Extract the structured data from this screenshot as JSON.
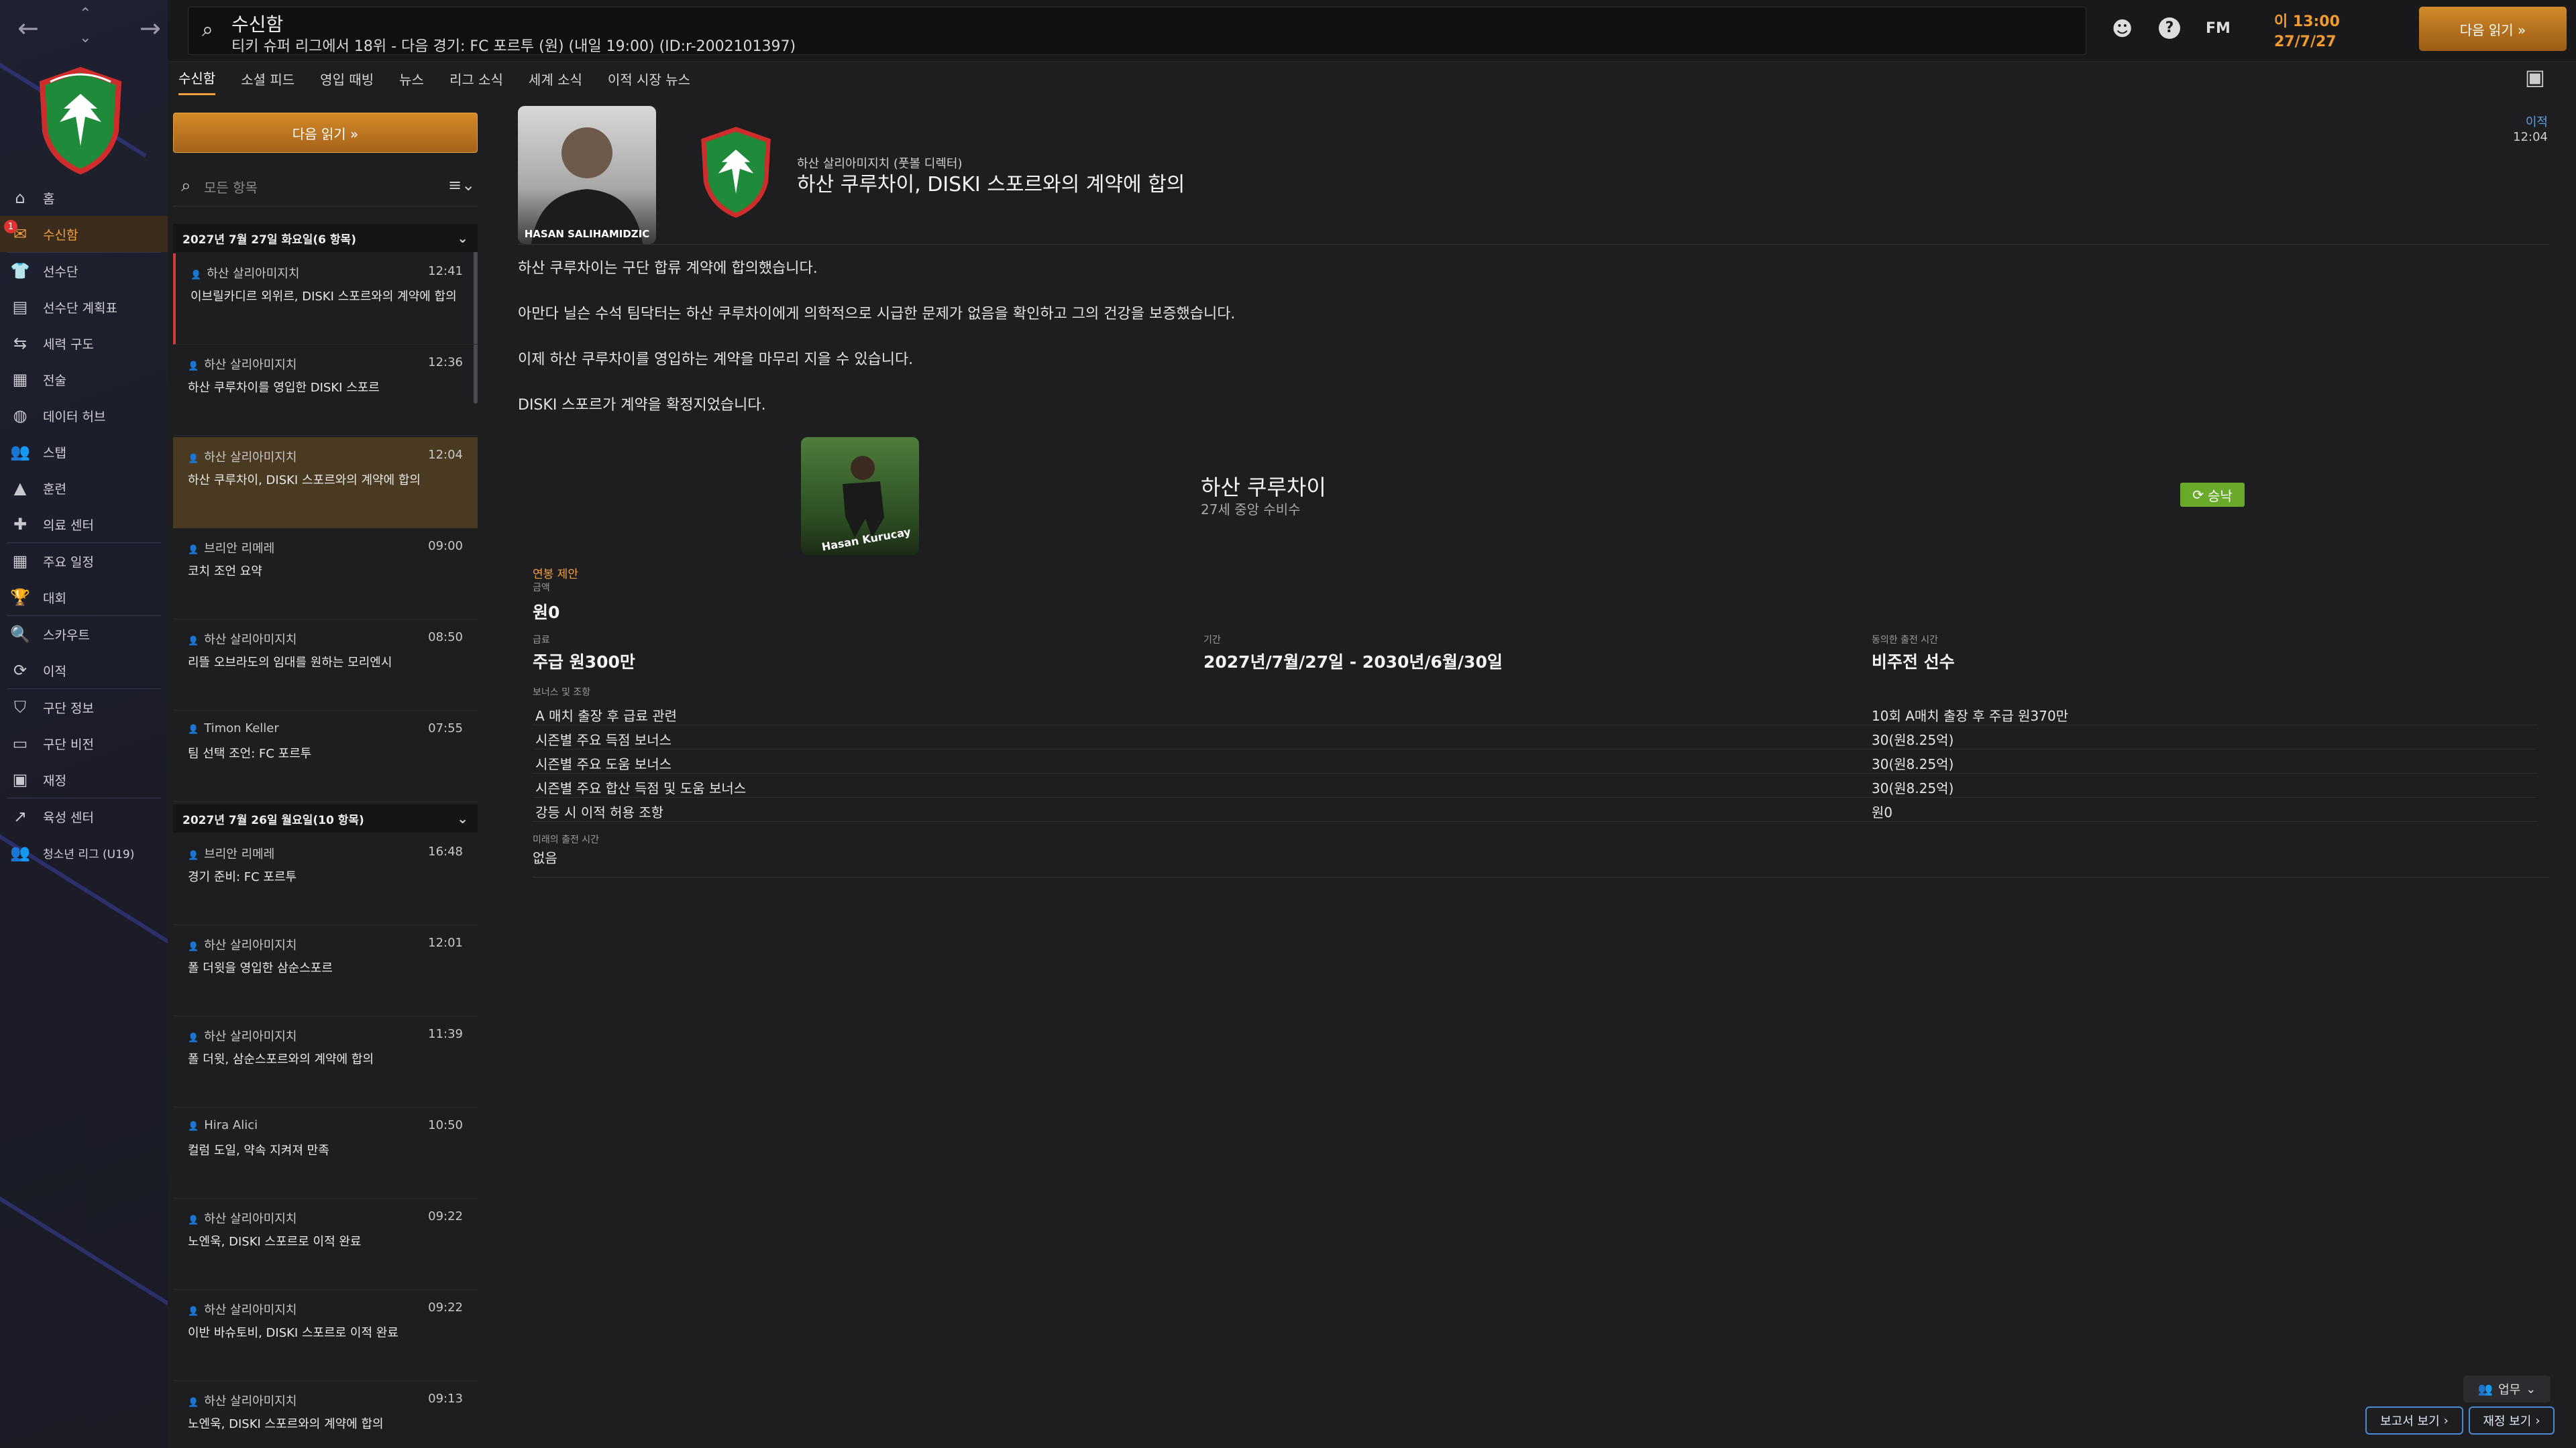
{
  "topbar": {
    "title": "수신함",
    "subtitle": "티키 슈퍼 리그에서 18위 - 다음 경기: FC 포르투 (원) (내일 19:00) (ID:r-2002101397)",
    "fm_label": "FM",
    "time": "이 13:00",
    "date": "27/7/27",
    "continue_label": "다음 읽기 »"
  },
  "sidebar": {
    "badge_count": "1",
    "items": [
      {
        "label": "홈",
        "icon": "home-icon"
      },
      {
        "label": "수신함",
        "icon": "inbox-icon"
      },
      {
        "label": "선수단",
        "icon": "squad-icon"
      },
      {
        "label": "선수단 계획표",
        "icon": "squad-planner-icon"
      },
      {
        "label": "세력 구도",
        "icon": "dynamics-icon"
      },
      {
        "label": "전술",
        "icon": "tactics-icon"
      },
      {
        "label": "데이터 허브",
        "icon": "data-hub-icon"
      },
      {
        "label": "스탭",
        "icon": "staff-icon"
      },
      {
        "label": "훈련",
        "icon": "training-icon"
      },
      {
        "label": "의료 센터",
        "icon": "medical-icon"
      },
      {
        "label": "주요 일정",
        "icon": "calendar-icon"
      },
      {
        "label": "대회",
        "icon": "trophy-icon"
      },
      {
        "label": "스카우트",
        "icon": "scouting-icon"
      },
      {
        "label": "이적",
        "icon": "transfers-icon"
      },
      {
        "label": "구단 정보",
        "icon": "club-info-icon"
      },
      {
        "label": "구단 비전",
        "icon": "club-vision-icon"
      },
      {
        "label": "재정",
        "icon": "finances-icon"
      },
      {
        "label": "육성 센터",
        "icon": "development-icon"
      },
      {
        "label": "청소년 리그 (U19)",
        "icon": "youth-icon"
      }
    ]
  },
  "tabs": [
    "수신함",
    "소셜 피드",
    "영입 때빙",
    "뉴스",
    "리그 소식",
    "세계 소식",
    "이적 시장 뉴스"
  ],
  "inbox": {
    "continue_label": "다음 읽기 »",
    "filter_placeholder": "모든 항목",
    "groups": [
      {
        "label": "2027년 7월 27일 화요일(6 항목)"
      },
      {
        "label": "2027년 7월 26일 월요일(10 항목)"
      }
    ],
    "messages": [
      {
        "sender": "하산 살리아미지치",
        "time": "12:41",
        "subject": "이브릴카디르 외위르, DISKI 스포르와의 계약에 합의"
      },
      {
        "sender": "하산 살리아미지치",
        "time": "12:36",
        "subject": "하산 쿠루차이를 영입한 DISKI 스포르"
      },
      {
        "sender": "하산 살리아미지치",
        "time": "12:04",
        "subject": "하산 쿠루차이, DISKI 스포르와의 계약에 합의"
      },
      {
        "sender": "브리안 리메레",
        "time": "09:00",
        "subject": "코치 조언 요약"
      },
      {
        "sender": "하산 살리아미지치",
        "time": "08:50",
        "subject": "리뜰 오브라도의 임대를 원하는 모리엔시"
      },
      {
        "sender": "Timon Keller",
        "time": "07:55",
        "subject": "팀 선택 조언: FC 포르투"
      },
      {
        "sender": "브리안 리메레",
        "time": "16:48",
        "subject": "경기 준비: FC 포르투"
      },
      {
        "sender": "하산 살리아미지치",
        "time": "12:01",
        "subject": "폴 더윗을 영입한 삼순스포르"
      },
      {
        "sender": "하산 살리아미지치",
        "time": "11:39",
        "subject": "폴 더윗, 삼순스포르와의 계약에 합의"
      },
      {
        "sender": "Hira Alici",
        "time": "10:50",
        "subject": "컬럼 도일, 약속 지켜져 만족"
      },
      {
        "sender": "하산 살리아미지치",
        "time": "09:22",
        "subject": "노엔욱, DISKI 스포르로 이적 완료"
      },
      {
        "sender": "하산 살리아미지치",
        "time": "09:22",
        "subject": "이반 바슈토비, DISKI 스포르로 이적 완료"
      },
      {
        "sender": "하산 살리아미지치",
        "time": "09:13",
        "subject": "노엔욱, DISKI 스포르와의 계약에 합의"
      }
    ]
  },
  "reader": {
    "photo_name": "HASAN SALIHAMIDZIC",
    "sender": "하산 살리아미지치 (풋볼 디렉터)",
    "title": "하산 쿠루차이, DISKI 스포르와의 계약에 합의",
    "meta_tag": "이적",
    "meta_time": "12:04",
    "paragraphs": [
      "하산 쿠루차이는 구단 합류 계약에 합의했습니다.",
      "아만다 닐슨 수석 팀닥터는 하산 쿠루차이에게 의학적으로 시급한 문제가 없음을 확인하고 그의 건강을 보증했습니다.",
      "이제 하산 쿠루차이를 영입하는 계약을 마무리 지을 수 있습니다.",
      "DISKI 스포르가 계약을 확정지었습니다."
    ],
    "player": {
      "card_name": "Hasan Kurucay",
      "name": "하산 쿠루차이",
      "desc": "27세 중앙 수비수",
      "status": "승낙"
    },
    "offer": {
      "header": "연봉 제안",
      "amount_label": "금액",
      "amount_value": "원0",
      "wage_label": "급료",
      "wage_value": "주급 원300만",
      "term_label": "기간",
      "term_value": "2027년/7월/27일 - 2030년/6월/30일",
      "status_label": "동의한 출전 시간",
      "status_value": "비주전 선수",
      "bonus_header": "보너스 및 조항",
      "bonuses": [
        {
          "label": "A 매치 출장 후 급료 관련",
          "value": "10회 A매치 출장 후 주급 원370만"
        },
        {
          "label": "시즌별 주요 득점 보너스",
          "value": "30(원8.25억)"
        },
        {
          "label": "시즌별 주요 도움 보너스",
          "value": "30(원8.25억)"
        },
        {
          "label": "시즌별 주요 합산 득점 및 도움 보너스",
          "value": "30(원8.25억)"
        },
        {
          "label": "강등 시 이적 허용 조항",
          "value": "원0"
        }
      ],
      "future_label": "미래의 출전 시간",
      "future_value": "없음"
    }
  },
  "footer": {
    "duty_label": "업무",
    "report_label": "보고서 보기",
    "finance_label": "재정 보기"
  },
  "colors": {
    "accent": "#f0a040",
    "accept": "#6aaa2a",
    "link": "#4c8ad8"
  }
}
